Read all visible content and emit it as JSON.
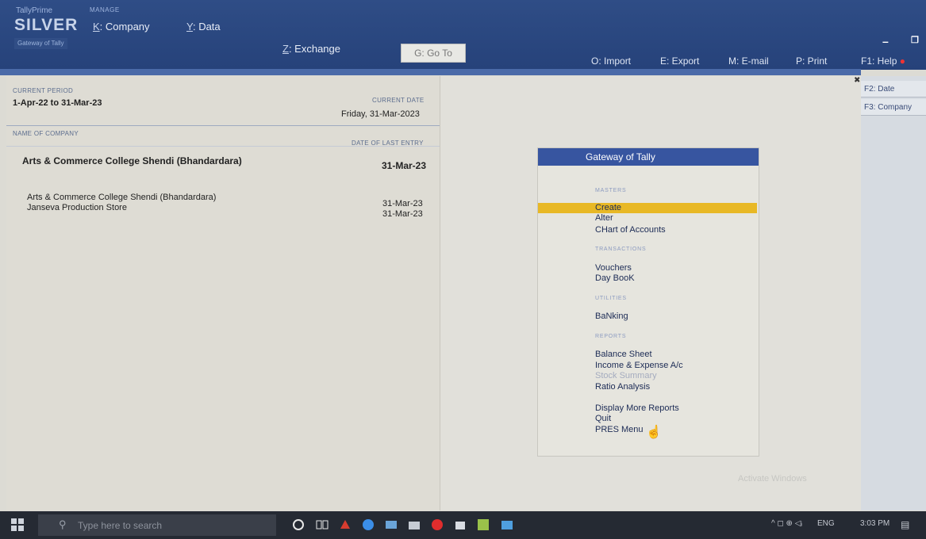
{
  "header": {
    "brand_top": "TallyPrime",
    "brand_manage": "MANAGE",
    "brand_silver": "SILVER",
    "brand_sub": "Gateway of Tally",
    "menus": [
      {
        "key": "K",
        "label": ": Company"
      },
      {
        "key": "Y",
        "label": ": Data"
      },
      {
        "key": "Z",
        "label": ": Exchange"
      }
    ],
    "goto": "G: Go To",
    "right_menus": [
      {
        "key": "O",
        "label": ": Import"
      },
      {
        "key": "E",
        "label": ": Export"
      },
      {
        "key": "M",
        "label": ": E-mail"
      },
      {
        "key": "P",
        "label": ": Print"
      },
      {
        "key": "F1",
        "label": ": Help"
      }
    ]
  },
  "left": {
    "current_period_label": "CURRENT PERIOD",
    "current_period": "1-Apr-22 to 31-Mar-23",
    "current_date_label": "CURRENT DATE",
    "current_date": "Friday, 31-Mar-2023",
    "name_label": "NAME OF COMPANY",
    "last_entry_label": "DATE OF LAST ENTRY",
    "active_company": "Arts & Commerce College Shendi (Bhandardara)",
    "active_date": "31-Mar-23",
    "companies": [
      {
        "name": "Arts & Commerce College Shendi (Bhandardara)",
        "date": "31-Mar-23"
      },
      {
        "name": "Janseva Production Store",
        "date": "31-Mar-23"
      }
    ]
  },
  "gateway": {
    "title": "Gateway of Tally",
    "masters": "MASTERS",
    "create": "Create",
    "alter": "Alter",
    "chart": "CHart of Accounts",
    "transactions": "TRANSACTIONS",
    "vouchers": "Vouchers",
    "daybook": "Day BooK",
    "utilities": "UTILITIES",
    "banking": "BaNking",
    "reports": "REPORTS",
    "balance": "Balance Sheet",
    "income": "Income & Expense A/c",
    "stock": "Stock Summary",
    "ratio": "Ratio Analysis",
    "more": "Display More Reports",
    "quit": "Quit",
    "pres": "PRES Menu"
  },
  "side": {
    "f2": "F2: Date",
    "f3": "F3: Company"
  },
  "watermark": "Activate Windows",
  "taskbar": {
    "search_placeholder": "Type here to search",
    "time": "3:03 PM",
    "lang": "ENG"
  }
}
